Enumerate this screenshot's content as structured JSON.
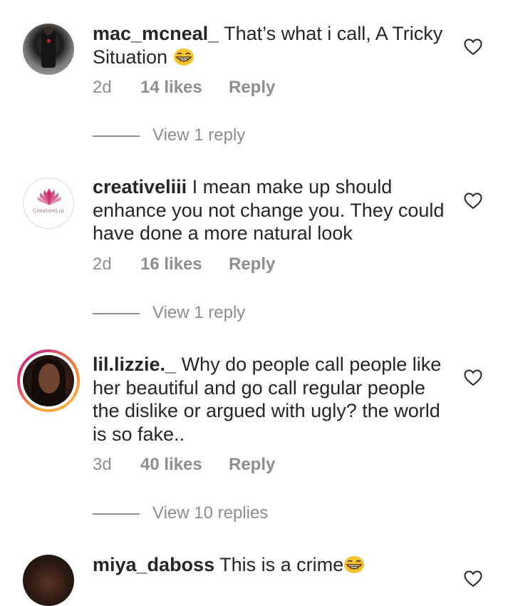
{
  "comments": [
    {
      "username": "mac_mcneal_",
      "text": "That’s what i call, A Tricky Situation",
      "emoji": "grinning-face-emoji",
      "age": "2d",
      "likes": "14 likes",
      "reply": "Reply",
      "view_replies": "View 1 reply"
    },
    {
      "username": "creativeliii",
      "avatar_logo_text": "CreativeLiii",
      "text": "I mean make up should enhance you not change you. They could have done a more natural look",
      "age": "2d",
      "likes": "16 likes",
      "reply": "Reply",
      "view_replies": "View 1 reply"
    },
    {
      "username": "lil.lizzie._",
      "text": "Why do people call people like her beautiful and go call regular people the dislike or argued with ugly? the world is so fake..",
      "age": "3d",
      "likes": "40 likes",
      "reply": "Reply",
      "view_replies": "View 10 replies"
    },
    {
      "username": "miya_daboss",
      "text": "This is a crime",
      "emoji": "grinning-face-emoji"
    }
  ],
  "icons": {
    "like": "heart-outline-icon"
  },
  "colors": {
    "text": "#262626",
    "secondary": "#8e8e8e",
    "story_ring_start": "#f9a23a",
    "story_ring_end": "#e1306c"
  }
}
